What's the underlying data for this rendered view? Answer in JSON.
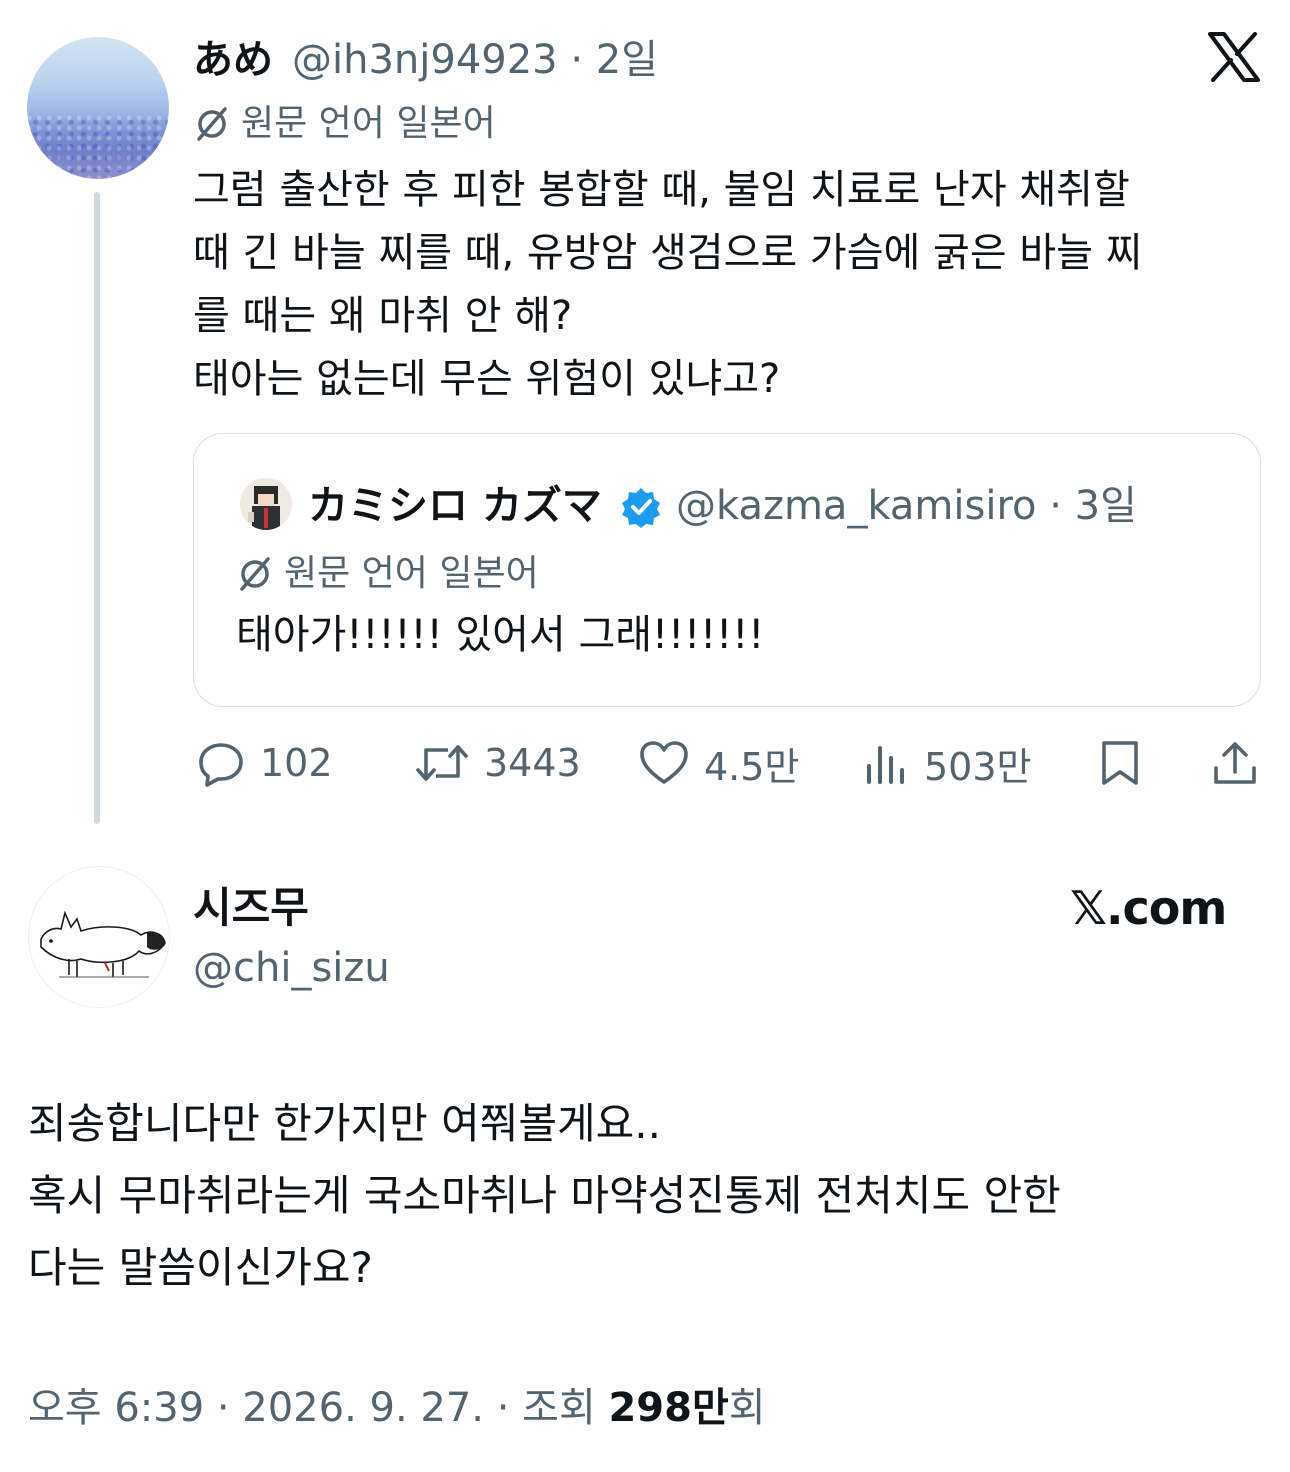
{
  "tweet": {
    "author_name": "あめ",
    "meta": "@ih3nj94923 · 2일",
    "translate_label": "원문 언어 일본어",
    "lines": [
      "그럼 출산한 후 피한 봉합할 때, 불임 치료로 난자 채취할",
      "때 긴 바늘 찌를 때, 유방암 생검으로 가슴에 굵은 바늘 찌",
      "를 때는 왜 마취 안 해?",
      "태아는 없는데 무슨 위험이 있냐고?"
    ],
    "quote": {
      "author_name": "カミシロ カズマ",
      "meta": "@kazma_kamisiro · 3일",
      "translate_label": "원문 언어 일본어",
      "text": "태아가!!!!!! 있어서 그래!!!!!!!"
    },
    "actions": {
      "replies": "102",
      "retweets": "3443",
      "likes": "4.5만",
      "views": "503만"
    }
  },
  "reply": {
    "author_name": "시즈무",
    "handle": "@chi_sizu",
    "watermark": "𝕏.com",
    "lines": [
      "죄송합니다만 한가지만 여쭤볼게요..",
      "혹시 무마취라는게 국소마취나 마약성진통제 전처치도 안한",
      "다는 말씀이신가요?"
    ],
    "footer_prefix": "오후 6:39 · 2026. 9. 27. · 조회 ",
    "footer_views": "298만",
    "footer_suffix": "회"
  },
  "colors": {
    "text": "#0f1419",
    "secondary": "#536471",
    "verified": "#1d9bf0",
    "border": "#d8e0e5"
  },
  "icons": [
    "x-logo-icon",
    "translate-icon",
    "verified-badge-icon",
    "reply-icon",
    "retweet-icon",
    "like-icon",
    "views-icon",
    "bookmark-icon",
    "share-icon"
  ]
}
